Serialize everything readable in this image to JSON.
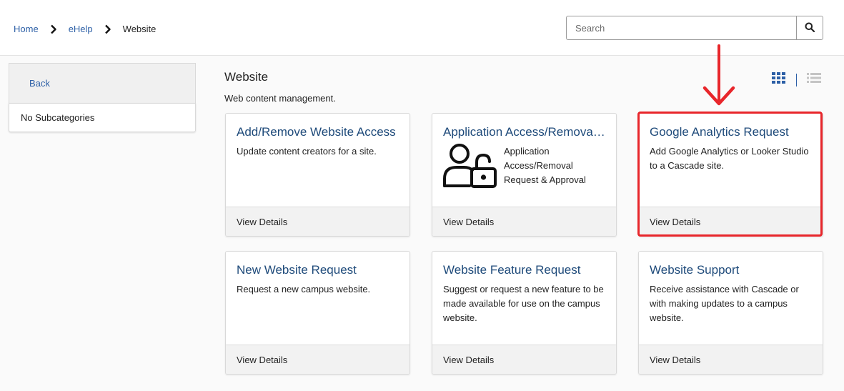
{
  "breadcrumb": {
    "home": "Home",
    "ehelp": "eHelp",
    "current": "Website"
  },
  "search": {
    "placeholder": "Search"
  },
  "sidebar": {
    "back_label": "Back",
    "empty_label": "No Subcategories"
  },
  "page": {
    "title": "Website",
    "description": "Web content management."
  },
  "colors": {
    "link": "#2c5fa6",
    "card_title": "#1e4a7a",
    "highlight": "#e8262b"
  },
  "cards": [
    {
      "title": "Add/Remove Website Access",
      "description": "Update content creators for a site.",
      "footer": "View Details"
    },
    {
      "title": "Application Access/Removal Request & Approval",
      "description": "Application Access/Removal Request & Approval",
      "footer": "View Details",
      "icon": "user-lock-icon"
    },
    {
      "title": "Google Analytics Request",
      "description": "Add Google Analytics or Looker Studio to a Cascade site.",
      "footer": "View Details"
    },
    {
      "title": "New Website Request",
      "description": "Request a new campus website.",
      "footer": "View Details"
    },
    {
      "title": "Website Feature Request",
      "description": "Suggest or request a new feature to be made available for use on the campus website.",
      "footer": "View Details"
    },
    {
      "title": "Website Support",
      "description": "Receive assistance with Cascade or with making updates to a campus website.",
      "footer": "View Details"
    }
  ]
}
